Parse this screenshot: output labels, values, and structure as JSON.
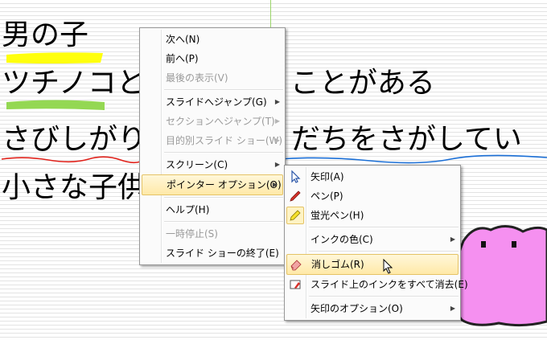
{
  "slide": {
    "line1": "男の子",
    "line2": "ツチノコと　　　　　ことがある",
    "line3": "さびしがり　　　　　だちをさがしてい",
    "line4": "小さな子供"
  },
  "context_menu": {
    "items": [
      {
        "label": "次へ(N)",
        "enabled": true
      },
      {
        "label": "前へ(P)",
        "enabled": true
      },
      {
        "label": "最後の表示(V)",
        "enabled": false
      },
      {
        "label": "スライドへジャンプ(G)",
        "enabled": true,
        "submenu": true
      },
      {
        "label": "セクションへジャンプ(T)",
        "enabled": false,
        "submenu": true
      },
      {
        "label": "目的別スライド ショー(W)",
        "enabled": false,
        "submenu": true
      },
      {
        "label": "スクリーン(C)",
        "enabled": true,
        "submenu": true
      },
      {
        "label": "ポインター オプション(O)",
        "enabled": true,
        "submenu": true,
        "highlighted": true
      },
      {
        "label": "ヘルプ(H)",
        "enabled": true
      },
      {
        "label": "一時停止(S)",
        "enabled": false
      },
      {
        "label": "スライド ショーの終了(E)",
        "enabled": true
      }
    ]
  },
  "pointer_submenu": {
    "items": [
      {
        "label": "矢印(A)",
        "icon": "arrow-pointer-icon"
      },
      {
        "label": "ペン(P)",
        "icon": "pen-icon"
      },
      {
        "label": "蛍光ペン(H)",
        "icon": "highlighter-icon",
        "checked": true
      },
      {
        "label": "インクの色(C)",
        "submenu": true
      },
      {
        "label": "消しゴム(R)",
        "icon": "eraser-icon",
        "highlighted": true
      },
      {
        "label": "スライド上のインクをすべて消去(E)",
        "icon": "erase-all-ink-icon"
      },
      {
        "label": "矢印のオプション(O)",
        "submenu": true
      }
    ]
  },
  "colors": {
    "yellow_highlight": "#ffff00",
    "green_highlight": "#8ed64a",
    "red_underline": "#e0221b",
    "blue_underline": "#1b6fd6",
    "pink_character": "#f590f0",
    "menu_highlight": "#ffe9a8"
  }
}
